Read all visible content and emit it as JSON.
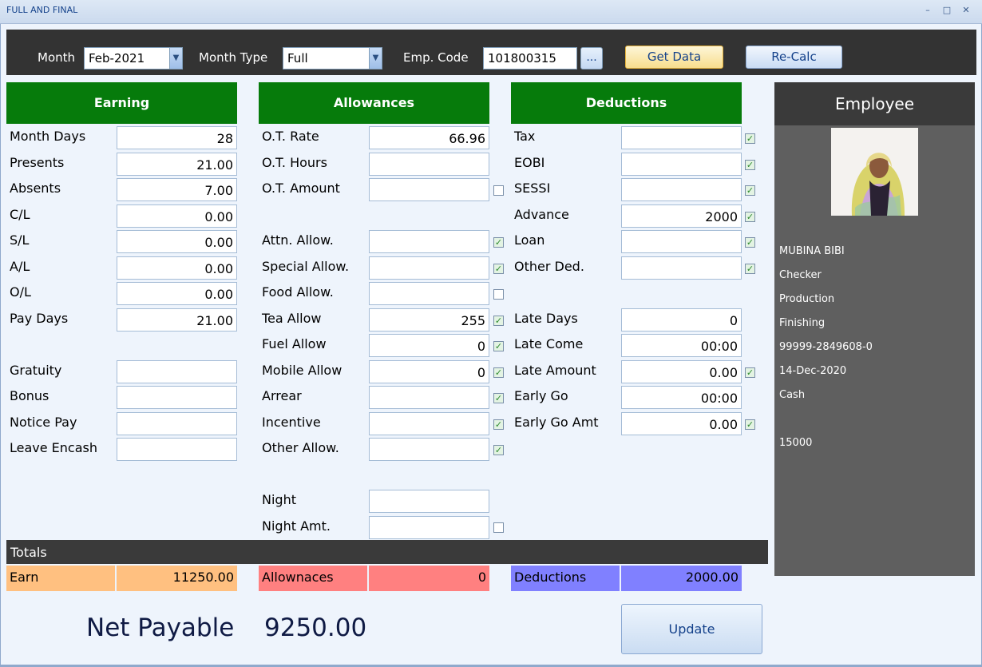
{
  "window": {
    "title": "FULL AND FINAL",
    "controls": [
      "–",
      "□",
      "✕"
    ]
  },
  "toolbar": {
    "month_label": "Month",
    "month_value": "Feb-2021",
    "month_type_label": "Month Type",
    "month_type_value": "Full",
    "emp_code_label": "Emp. Code",
    "emp_code_value": "101800315",
    "browse_label": "...",
    "get_data_label": "Get Data",
    "recalc_label": "Re-Calc"
  },
  "earning": {
    "header": "Earning",
    "rows": [
      {
        "label": "Month Days",
        "value": "28"
      },
      {
        "label": "Presents",
        "value": "21.00"
      },
      {
        "label": "Absents",
        "value": "7.00"
      },
      {
        "label": "C/L",
        "value": "0.00"
      },
      {
        "label": "S/L",
        "value": "0.00"
      },
      {
        "label": "A/L",
        "value": "0.00"
      },
      {
        "label": "O/L",
        "value": "0.00"
      },
      {
        "label": "Pay Days",
        "value": "21.00"
      },
      {
        "label": "Gratuity",
        "value": ""
      },
      {
        "label": "Bonus",
        "value": ""
      },
      {
        "label": "Notice Pay",
        "value": ""
      },
      {
        "label": "Leave Encash",
        "value": ""
      }
    ]
  },
  "allowances": {
    "header": "Allowances",
    "rows": [
      {
        "label": "O.T. Rate",
        "value": "66.96",
        "check": null
      },
      {
        "label": "O.T. Hours",
        "value": "",
        "check": null
      },
      {
        "label": "O.T. Amount",
        "value": "",
        "check": false
      },
      {
        "label": "Attn. Allow.",
        "value": "",
        "check": true
      },
      {
        "label": "Special Allow.",
        "value": "",
        "check": true
      },
      {
        "label": "Food Allow.",
        "value": "",
        "check": false
      },
      {
        "label": "Tea Allow",
        "value": "255",
        "check": true
      },
      {
        "label": "Fuel Allow",
        "value": "0",
        "check": true
      },
      {
        "label": "Mobile Allow",
        "value": "0",
        "check": true
      },
      {
        "label": "Arrear",
        "value": "",
        "check": true
      },
      {
        "label": "Incentive",
        "value": "",
        "check": true
      },
      {
        "label": "Other Allow.",
        "value": "",
        "check": true
      },
      {
        "label": "Night",
        "value": "",
        "check": null
      },
      {
        "label": "Night Amt.",
        "value": "",
        "check": false
      }
    ]
  },
  "deductions": {
    "header": "Deductions",
    "rows": [
      {
        "label": "Tax",
        "value": "",
        "check": true
      },
      {
        "label": "EOBI",
        "value": "",
        "check": true
      },
      {
        "label": "SESSI",
        "value": "",
        "check": true
      },
      {
        "label": "Advance",
        "value": "2000",
        "check": true
      },
      {
        "label": "Loan",
        "value": "",
        "check": true
      },
      {
        "label": "Other Ded.",
        "value": "",
        "check": true
      },
      {
        "label": "Late Days",
        "value": "0",
        "check": null
      },
      {
        "label": "Late Come",
        "value": "00:00",
        "check": null
      },
      {
        "label": "Late Amount",
        "value": "0.00",
        "check": true
      },
      {
        "label": "Early Go",
        "value": "00:00",
        "check": null
      },
      {
        "label": "Early Go Amt",
        "value": "0.00",
        "check": true
      }
    ]
  },
  "employee": {
    "header": "Employee",
    "name": "MUBINA BIBI",
    "designation": "Checker",
    "department": "Production",
    "section": "Finishing",
    "cnic": "99999-2849608-0",
    "date": "14-Dec-2020",
    "payment_mode": "Cash",
    "salary": "15000"
  },
  "totals": {
    "header": "Totals",
    "earn_label": "Earn",
    "earn_value": "11250.00",
    "allow_label": "Allownaces",
    "allow_value": "0",
    "ded_label": "Deductions",
    "ded_value": "2000.00",
    "net_label": "Net Payable",
    "net_value": "9250.00",
    "update_label": "Update"
  },
  "colors": {
    "section_header": "#067b0b",
    "earn_cell": "#ffc080",
    "allow_cell": "#ff8080",
    "ded_cell": "#8080ff",
    "panel_dark": "#3a3a3a"
  }
}
